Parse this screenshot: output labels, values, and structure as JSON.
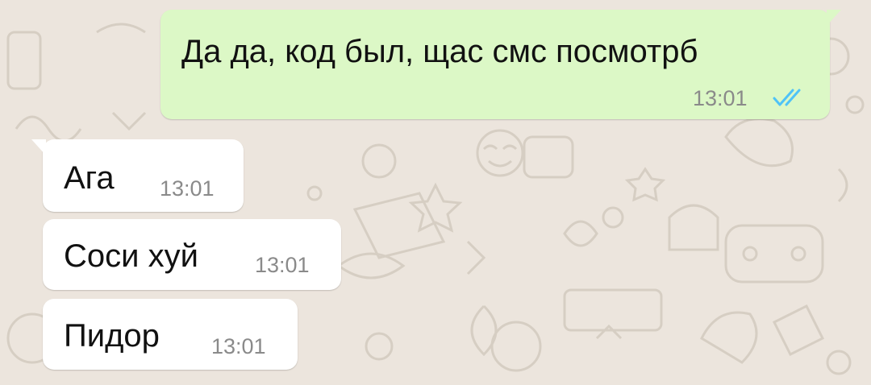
{
  "messages": [
    {
      "direction": "outgoing",
      "text": "Да да, код был, щас смс посмотрб",
      "time": "13:01",
      "status_icon": "double-check-read-icon"
    },
    {
      "direction": "incoming",
      "text": "Ага",
      "time": "13:01"
    },
    {
      "direction": "incoming",
      "text": "Соси хуй",
      "time": "13:01"
    },
    {
      "direction": "incoming",
      "text": "Пидор",
      "time": "13:01"
    }
  ],
  "colors": {
    "chat_background": "#ece5dd",
    "outgoing_bubble": "#dcf8c6",
    "incoming_bubble": "#ffffff",
    "read_ticks": "#4fc3f7",
    "time_text": "#8a8a8a"
  }
}
